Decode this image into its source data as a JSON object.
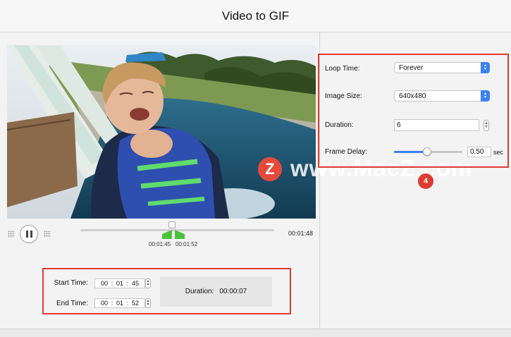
{
  "window": {
    "title": "Video to GIF"
  },
  "player": {
    "total_time": "00:01:48",
    "marker_start_time": "00:01:45",
    "marker_end_time": "00:01:52",
    "position_fraction": 0.485
  },
  "range": {
    "start_label": "Start Time:",
    "start": {
      "hh": "00",
      "mm": "01",
      "ss": "45"
    },
    "end_label": "End Time:",
    "end": {
      "hh": "00",
      "mm": "01",
      "ss": "52"
    },
    "duration_label": "Duration:",
    "duration_value": "00:00:07"
  },
  "settings": {
    "loop_time_label": "Loop Time:",
    "loop_time_value": "Forever",
    "image_size_label": "Image Size:",
    "image_size_value": "640x480",
    "duration_label": "Duration:",
    "duration_value": "6",
    "frame_delay_label": "Frame Delay:",
    "frame_delay_value": "0.50",
    "frame_delay_unit": "sec",
    "frame_delay_fraction": 0.48
  },
  "watermark": {
    "logo_letter": "Z",
    "text": "www.MacZ.com"
  },
  "annotation": {
    "step_badge": "4"
  },
  "colors": {
    "accent": "#3b82f0",
    "annotation_red": "#e03c31",
    "marker_green": "#4cc13e"
  },
  "icons": {
    "pause": "pause-icon",
    "stepper": "stepper-arrows-icon",
    "popup": "popup-arrows-icon"
  }
}
